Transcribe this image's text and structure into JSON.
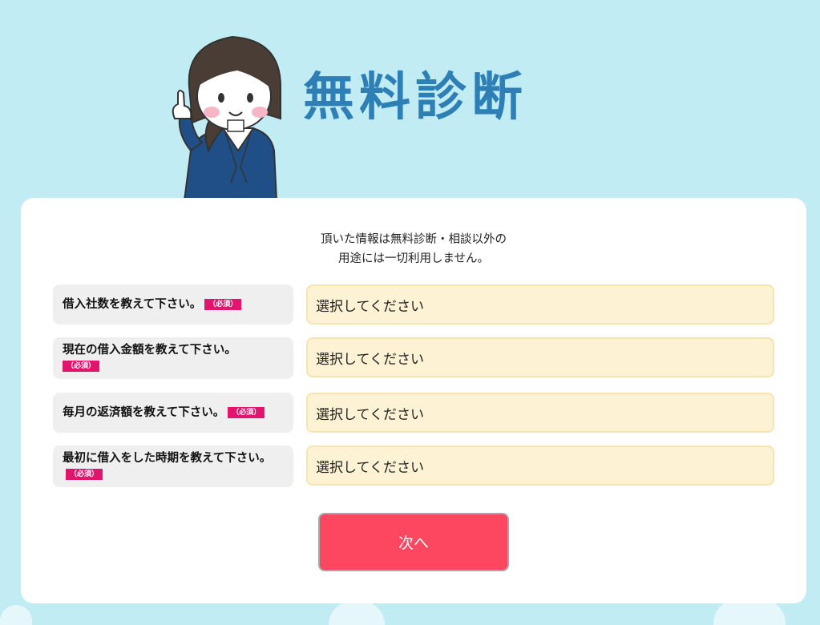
{
  "header": {
    "title": "無料診断"
  },
  "notice": {
    "line1": "頂いた情報は無料診断・相談以外の",
    "line2": "用途には一切利用しません。"
  },
  "required_label": "（必須）",
  "questions": [
    {
      "label": "借入社数を教えて下さい。",
      "placeholder": "選択してください"
    },
    {
      "label": "現在の借入金額を教えて下さい。",
      "placeholder": "選択してください"
    },
    {
      "label": "毎月の返済額を教えて下さい。",
      "placeholder": "選択してください"
    },
    {
      "label": "最初に借入をした時期を教えて下さい。",
      "placeholder": "選択してください"
    }
  ],
  "next_button": {
    "label": "次へ"
  },
  "colors": {
    "background": "#c2ecf4",
    "title": "#2d7fb6",
    "badge": "#e2146e",
    "select_bg": "#fdf2d3",
    "button": "#fd4761"
  }
}
